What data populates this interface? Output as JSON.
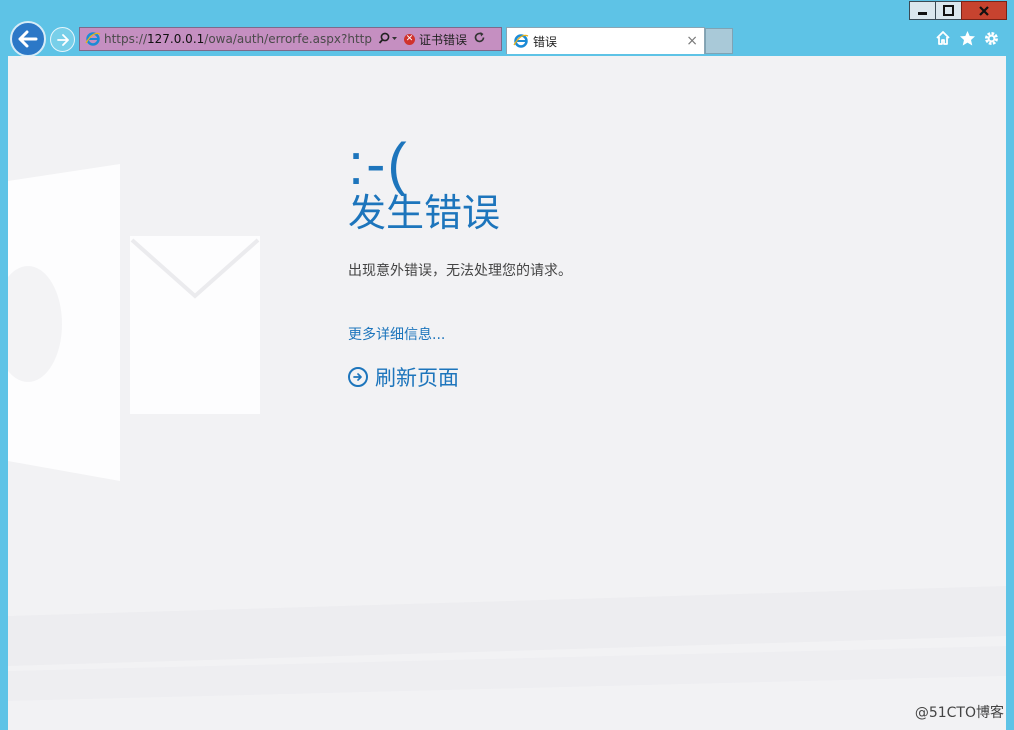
{
  "browser": {
    "address_url_prefix": "https://",
    "address_url_host": "127.0.0.1",
    "address_url_rest": "/owa/auth/errorfe.aspx?httpCo",
    "cert_error_label": "证书错误",
    "tab_title": "错误",
    "tab_close_glyph": "×"
  },
  "page": {
    "emoticon": ":-(",
    "heading": "发生错误",
    "message": "出现意外错误，无法处理您的请求。",
    "more_details_link": "更多详细信息...",
    "refresh_link": "刷新页面"
  },
  "watermark": "@51CTO博客",
  "colors": {
    "accent": "#1d75bc",
    "chrome": "#5ec3e6",
    "page_bg": "#f2f2f4",
    "address_bar_cert_error": "#c58fc1",
    "close_button": "#c7432f"
  },
  "icons": {
    "back": "back-arrow-icon",
    "forward": "forward-arrow-icon",
    "ie": "internet-explorer-icon",
    "search": "search-icon",
    "cert_error": "cert-error-icon",
    "refresh": "refresh-icon",
    "home": "home-icon",
    "favorites": "star-icon",
    "tools": "gear-icon",
    "refresh_page": "circle-arrow-right-icon"
  }
}
